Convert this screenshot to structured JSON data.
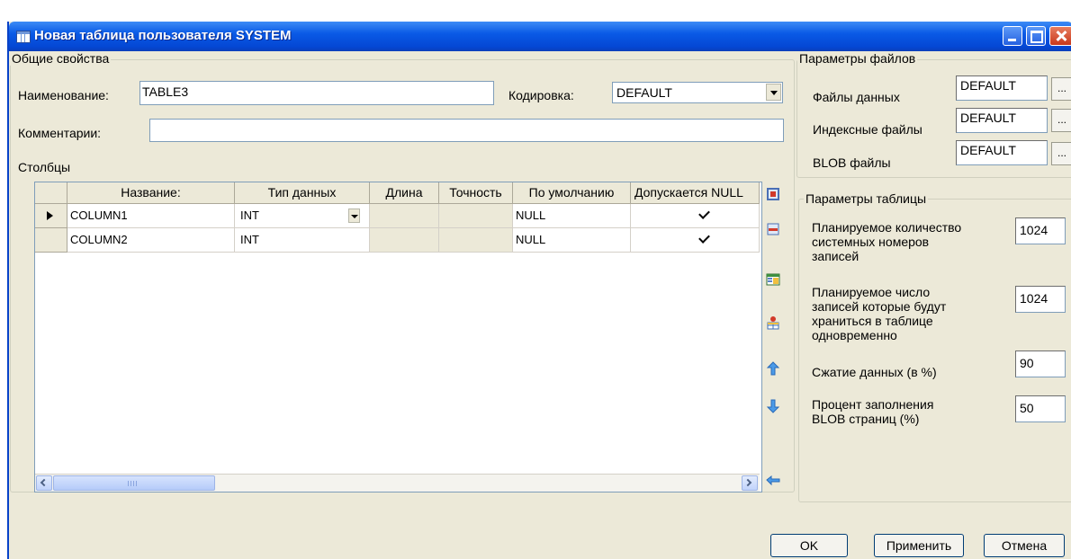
{
  "window": {
    "title": "Новая таблица пользователя SYSTEM"
  },
  "general": {
    "legend": "Общие свойства",
    "name_label": "Наименование:",
    "name_value": "TABLE3",
    "encoding_label": "Кодировка:",
    "encoding_value": "DEFAULT",
    "comment_label": "Комментарии:",
    "comment_value": "",
    "columns_label": "Столбцы"
  },
  "grid": {
    "headers": [
      "Название:",
      "Тип данных",
      "Длина",
      "Точность",
      "По умолчанию",
      "Допускается NULL"
    ],
    "rows": [
      {
        "name": "COLUMN1",
        "type": "INT",
        "default": "NULL",
        "nullable": true,
        "current": true
      },
      {
        "name": "COLUMN2",
        "type": "INT",
        "default": "NULL",
        "nullable": true,
        "current": false
      }
    ],
    "toolbar_icons": [
      "insert-column-icon",
      "delete-column-icon",
      "table-properties-icon",
      "add-from-template-icon",
      "move-up-icon",
      "move-down-icon",
      "enter-icon"
    ]
  },
  "file_params": {
    "legend": "Параметры файлов",
    "items": [
      {
        "label": "Файлы данных",
        "value": "DEFAULT",
        "button": "..."
      },
      {
        "label": "Индексные файлы",
        "value": "DEFAULT",
        "button": "..."
      },
      {
        "label": "BLOB файлы",
        "value": "DEFAULT",
        "button": "..."
      }
    ]
  },
  "table_params": {
    "legend": "Параметры таблицы",
    "items": [
      {
        "label_lines": [
          "Планируемое количество",
          "системных номеров",
          "записей"
        ],
        "value": "1024"
      },
      {
        "label_lines": [
          "Планируемое число",
          "записей которые будут",
          "храниться в таблице",
          "одновременно"
        ],
        "value": "1024"
      },
      {
        "label_lines": [
          "Сжатие данных (в %)"
        ],
        "value": "90"
      },
      {
        "label_lines": [
          "Процент заполнения",
          "BLOB страниц (%)"
        ],
        "value": "50"
      }
    ]
  },
  "buttons": {
    "ok": "OK",
    "apply": "Применить",
    "cancel": "Отмена"
  },
  "colors": {
    "titlebar": "#0a5ae6",
    "dialog": "#ece9d8",
    "input_border": "#7f9db9"
  }
}
